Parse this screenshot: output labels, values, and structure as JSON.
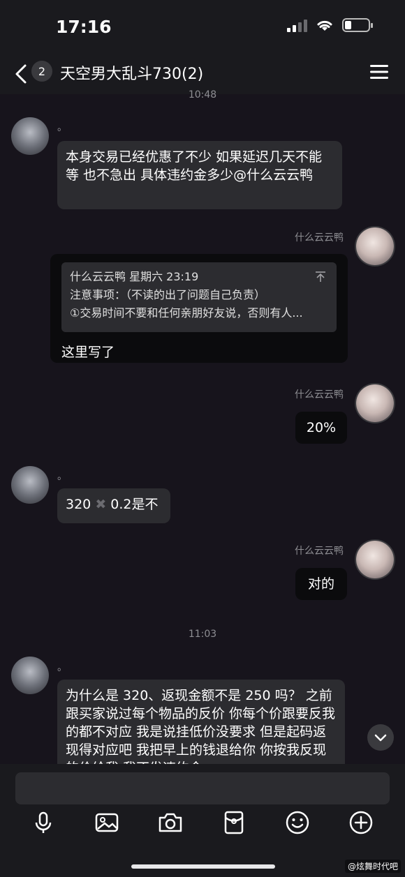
{
  "status_bar": {
    "time": "17:16"
  },
  "nav": {
    "badge": "2",
    "title": "天空男大乱斗730(2)"
  },
  "time_separators": [
    "10:48",
    "11:03"
  ],
  "messages": [
    {
      "side": "left",
      "sender": "。",
      "text": "本身交易已经优惠了不少 如果延迟几天不能等 也不急出 具体违约金多少@什么云云鸭"
    },
    {
      "side": "right",
      "sender": "什么云云鸭",
      "quote": {
        "header": "什么云云鸭 星期六 23:19",
        "line1": "注意事项：（不读的出了问题自己负责）",
        "line2": "①交易时间不要和任何亲朋好友说，否则有人..."
      },
      "text": "这里写了"
    },
    {
      "side": "right",
      "sender": "什么云云鸭",
      "text": "20%"
    },
    {
      "side": "left",
      "sender": "。",
      "text_a": "320",
      "icon": "✖",
      "text_b": "0.2是不"
    },
    {
      "side": "right",
      "sender": "什么云云鸭",
      "text": "对的"
    },
    {
      "side": "left",
      "sender": "。",
      "text": "为什么是 320、返现金额不是 250 吗？ 之前跟买家说过每个物品的反价 你每个价跟要反我的都不对应 我是说挂低价没要求 但是起码返现得对应吧 我把早上的钱退给你 你按我反现的价给我 我不发违约金"
    }
  ],
  "input": {
    "placeholder": ""
  },
  "watermark": "@炫舞时代吧",
  "colors": {
    "background": "#17141c",
    "bubble_left": "#2c2c30",
    "bubble_right": "#0b0b0d",
    "muted_text": "#8e8e93"
  },
  "toolbar_icons": [
    "microphone-icon",
    "image-icon",
    "camera-icon",
    "red-packet-icon",
    "emoji-icon",
    "plus-icon"
  ]
}
